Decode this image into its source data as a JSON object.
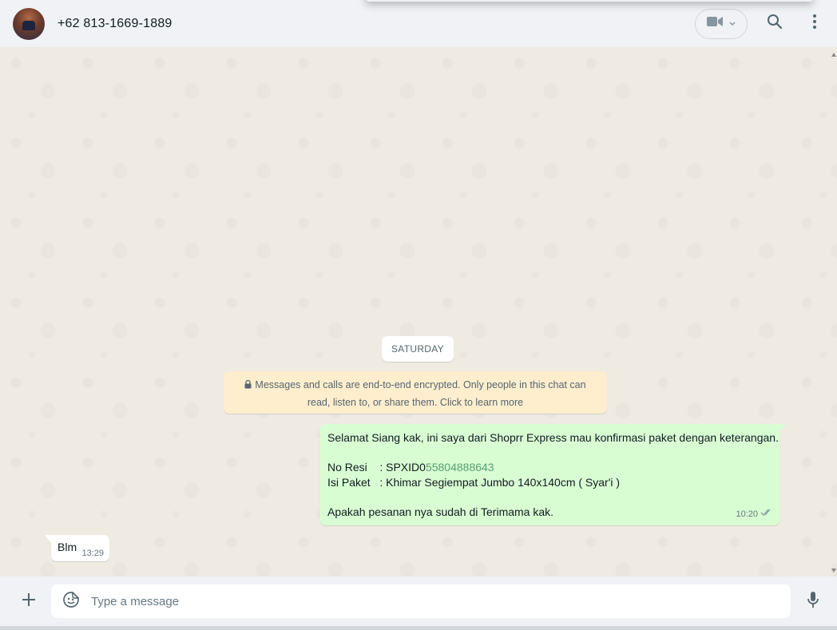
{
  "header": {
    "contact_name": "+62 813-1669-1889"
  },
  "chat": {
    "date_label": "SATURDAY",
    "encryption_notice": "Messages and calls are end-to-end encrypted. Only people in this chat can read, listen to, or share them. Click to learn more",
    "outgoing_message": {
      "line1": "Selamat Siang kak, ini saya dari Shoprr Express mau konfirmasi paket dengan keterangan.",
      "resi_label": "No Resi    : SPXID0",
      "resi_number": "55804888643",
      "paket_line": "Isi Paket   : Khimar Segiempat Jumbo 140x140cm ( Syar'i )",
      "closing": "Apakah pesanan nya sudah di Terimama kak.",
      "time": "10:20",
      "status": "read"
    },
    "incoming_message": {
      "text": "Blm",
      "time": "13:29"
    }
  },
  "footer": {
    "input_placeholder": "Type a message",
    "input_value": ""
  },
  "colors": {
    "outgoing_bubble": "#d9fdd3",
    "incoming_bubble": "#ffffff",
    "encryption_bg": "#ffeecd",
    "chat_bg": "#efeae2",
    "bar_bg": "#f0f2f5",
    "link_green": "#53a06e"
  }
}
